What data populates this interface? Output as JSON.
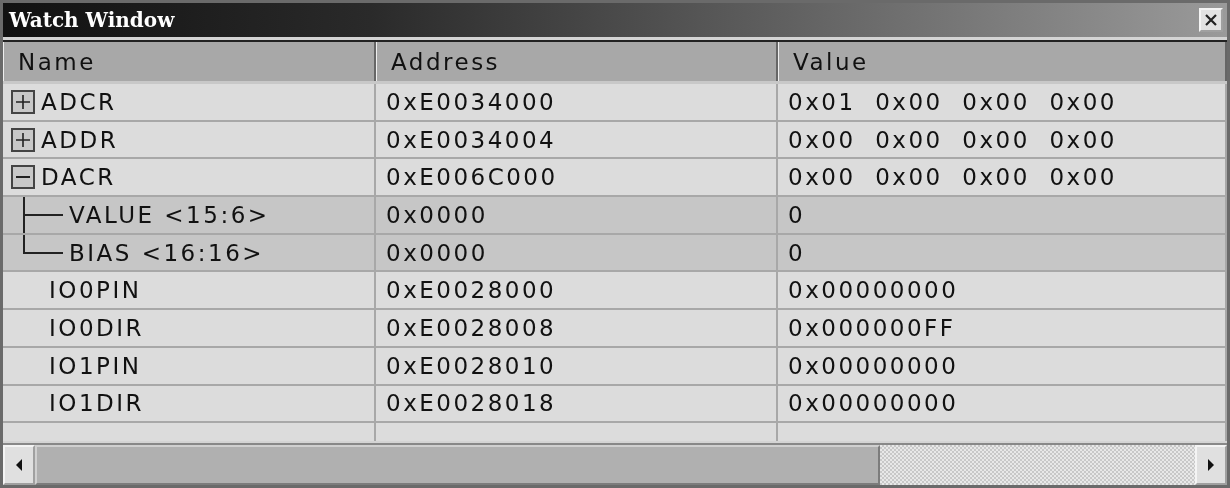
{
  "window": {
    "title": "Watch Window"
  },
  "columns": [
    "Name",
    "Address",
    "Value"
  ],
  "rows": [
    {
      "name": "ADCR",
      "address": "0xE0034000",
      "value": "0x01  0x00  0x00  0x00",
      "kind": "expandable",
      "expanded": false
    },
    {
      "name": "ADDR",
      "address": "0xE0034004",
      "value": "0x00  0x00  0x00  0x00",
      "kind": "expandable",
      "expanded": false
    },
    {
      "name": "DACR",
      "address": "0xE006C000",
      "value": "0x00  0x00  0x00  0x00",
      "kind": "expandable",
      "expanded": true,
      "children": [
        {
          "name": "VALUE <15:6>",
          "address": "0x0000",
          "value": "0"
        },
        {
          "name": "BIAS <16:16>",
          "address": "0x0000",
          "value": "0"
        }
      ]
    },
    {
      "name": "IO0PIN",
      "address": "0xE0028000",
      "value": "0x00000000",
      "kind": "plain"
    },
    {
      "name": "IO0DIR",
      "address": "0xE0028008",
      "value": "0x000000FF",
      "kind": "plain"
    },
    {
      "name": "IO1PIN",
      "address": "0xE0028010",
      "value": "0x00000000",
      "kind": "plain"
    },
    {
      "name": "IO1DIR",
      "address": "0xE0028018",
      "value": "0x00000000",
      "kind": "plain"
    }
  ]
}
